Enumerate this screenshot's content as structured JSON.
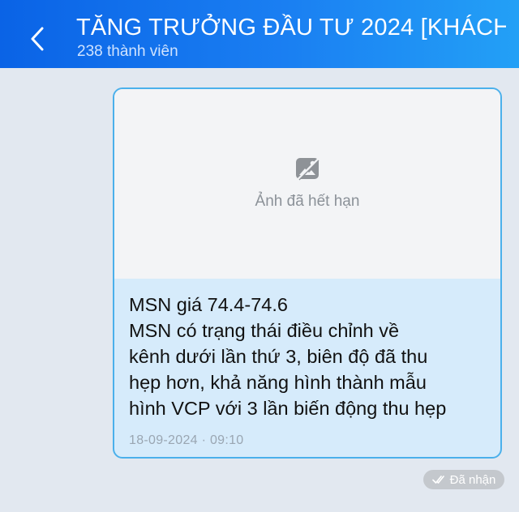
{
  "header": {
    "title": "TĂNG TRƯỞNG ĐẦU TƯ 2024 [KHÁCH...",
    "subtitle": "238 thành viên",
    "back_icon": "chevron-left-icon"
  },
  "message": {
    "image_expired_label": "Ảnh đã hết hạn",
    "image_icon": "broken-image-icon",
    "lines": [
      "MSN giá 74.4-74.6",
      "MSN có trạng thái điều chỉnh về",
      "kênh dưới lần thứ 3, biên độ đã thu",
      "hẹp hơn, khả năng hình thành mẫu",
      "hình VCP với 3 lần biến động thu hẹp"
    ],
    "timestamp": "18-09-2024 · 09:10"
  },
  "status": {
    "label": "Đã nhận",
    "icon": "double-check-icon"
  },
  "colors": {
    "header_start": "#0a63e6",
    "header_end": "#23a0f6",
    "bubble_bg": "#d6ebfb",
    "bubble_border": "#4bb0eb",
    "chat_bg": "#e2e8f0"
  }
}
